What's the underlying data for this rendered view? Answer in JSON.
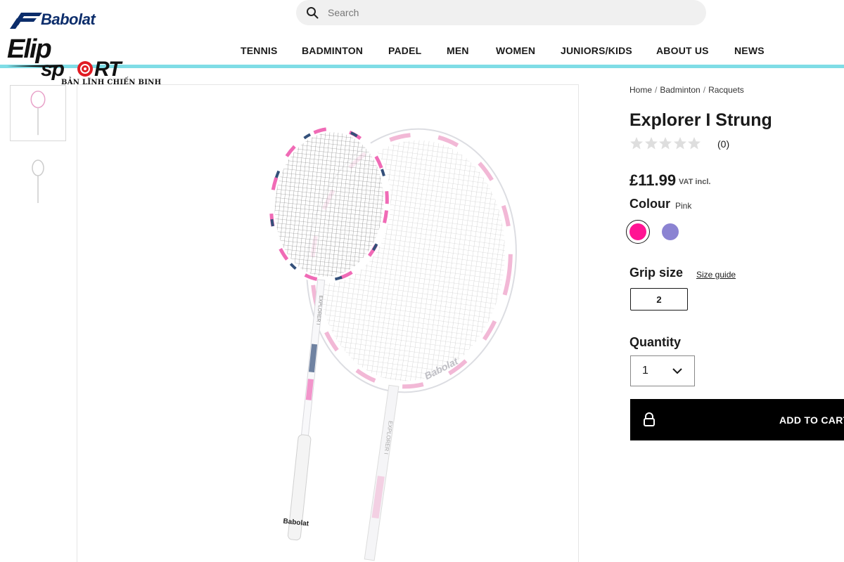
{
  "header": {
    "brand_logo": "Babolat",
    "dealer_logo": "Elip Sport",
    "dealer_tagline": "BẢN LĨNH CHIẾN BINH",
    "search_placeholder": "Search",
    "search_icon": "search-icon",
    "nav": [
      "TENNIS",
      "BADMINTON",
      "PADEL",
      "MEN",
      "WOMEN",
      "JUNIORS/KIDS",
      "ABOUT US",
      "NEWS"
    ],
    "accent_color": "#7fdde6",
    "brand_color": "#0c2d6b"
  },
  "gallery": {
    "thumbnail_count": 2,
    "active_thumbnail": 0,
    "main_image_text": [
      "Babolat",
      "EXPLORER I",
      "Babolat",
      "EXPLORER I"
    ]
  },
  "product": {
    "breadcrumb": [
      "Home",
      "Badminton",
      "Racquets"
    ],
    "title": "Explorer I Strung",
    "rating": 0,
    "rating_max": 5,
    "review_count": "(0)",
    "price": "£11.99",
    "vat_note": "VAT incl.",
    "colour_label": "Colour",
    "colour_value": "Pink",
    "colours": [
      {
        "name": "Pink",
        "hex": "#ff1493",
        "selected": true
      },
      {
        "name": "Purple",
        "hex": "#8b83d2",
        "selected": false
      }
    ],
    "grip_label": "Grip size",
    "size_guide_label": "Size guide",
    "grip_options": [
      "2"
    ],
    "quantity_label": "Quantity",
    "quantity_value": "1",
    "add_to_cart_label": "ADD TO CART",
    "add_to_cart_icon": "lock-icon"
  }
}
